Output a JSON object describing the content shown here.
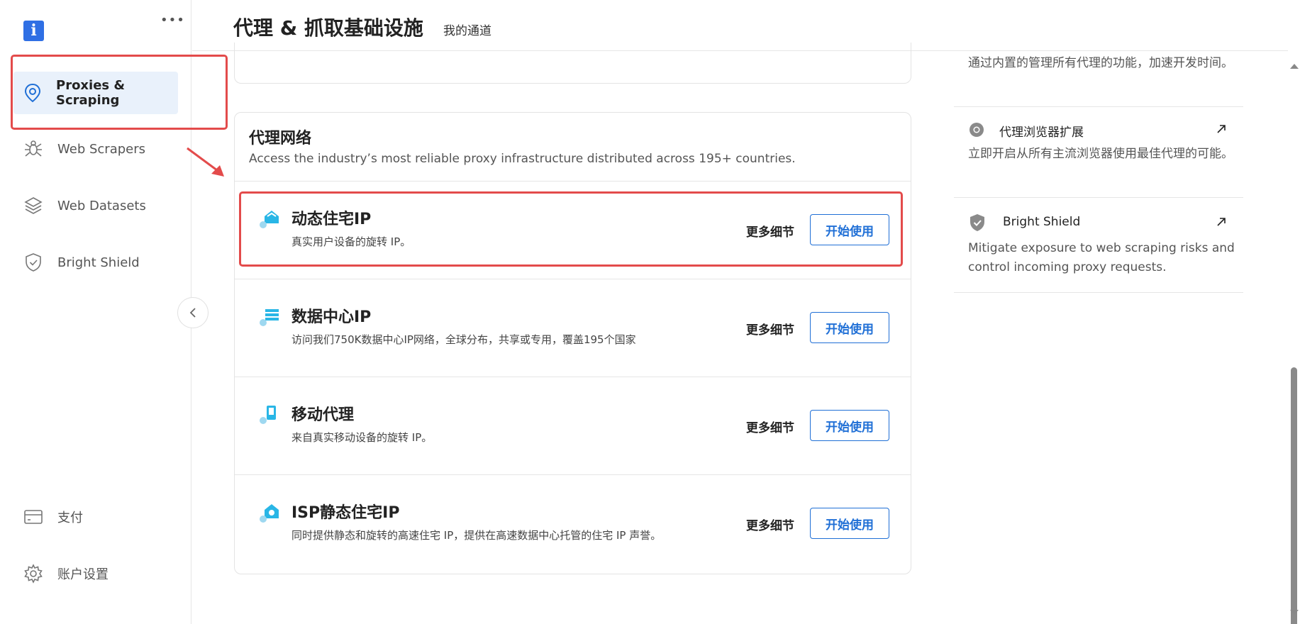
{
  "sidebar": {
    "logo_glyph": "i",
    "more_glyph": "•••",
    "items": [
      {
        "label": "Proxies & Scraping",
        "icon": "location-pin-icon",
        "active": true
      },
      {
        "label": "Web Scrapers",
        "icon": "spider-icon",
        "active": false
      },
      {
        "label": "Web Datasets",
        "icon": "layers-icon",
        "active": false
      },
      {
        "label": "Bright Shield",
        "icon": "shield-check-icon",
        "active": false
      }
    ],
    "bottom_items": [
      {
        "label": "支付",
        "icon": "credit-card-icon"
      },
      {
        "label": "账户设置",
        "icon": "gear-icon"
      }
    ]
  },
  "header": {
    "title": "代理 & 抓取基础设施",
    "subtitle": "我的通道"
  },
  "proxy_network": {
    "title": "代理网络",
    "description": "Access the industry’s most reliable proxy infrastructure distributed across 195+ countries.",
    "rows": [
      {
        "title": "动态住宅IP",
        "desc": "真实用户设备的旋转 IP。",
        "more": "更多细节",
        "start": "开始使用",
        "icon": "residential-house-icon"
      },
      {
        "title": "数据中心IP",
        "desc": "访问我们750K数据中心IP网络，全球分布，共享或专用，覆盖195个国家",
        "more": "更多细节",
        "start": "开始使用",
        "icon": "datacenter-server-icon"
      },
      {
        "title": "移动代理",
        "desc": "来自真实移动设备的旋转 IP。",
        "more": "更多细节",
        "start": "开始使用",
        "icon": "mobile-phone-icon"
      },
      {
        "title": "ISP静态住宅IP",
        "desc": "同时提供静态和旋转的高速住宅 IP，提供在高速数据中心托管的住宅 IP 声誉。",
        "more": "更多细节",
        "start": "开始使用",
        "icon": "isp-house-icon"
      }
    ]
  },
  "right_column": {
    "top_text": "通过内置的管理所有代理的功能，加速开发时间。",
    "items": [
      {
        "title": "代理浏览器扩展",
        "desc": "立即开启从所有主流浏览器使用最佳代理的可能。",
        "icon": "chrome-icon"
      },
      {
        "title": "Bright Shield",
        "desc": "Mitigate exposure to web scraping risks and control incoming proxy requests.",
        "icon": "shield-check-filled-icon"
      }
    ]
  },
  "colors": {
    "accent": "#1f6fd6",
    "annotation_red": "#e34b4b",
    "active_bg": "#e9f1fb",
    "icon_teal": "#29b6e6"
  }
}
